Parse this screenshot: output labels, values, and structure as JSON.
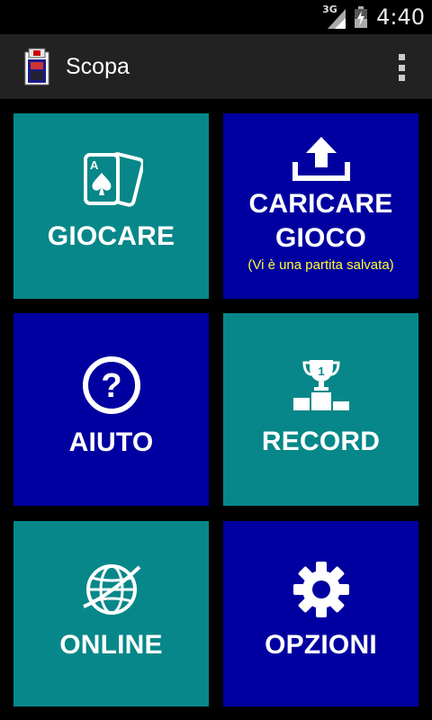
{
  "statusbar": {
    "network": "3G",
    "time": "4:40",
    "icons": [
      "signal-icon",
      "battery-charging-icon"
    ]
  },
  "appbar": {
    "title": "Scopa",
    "icons": [
      "app-logo-icon",
      "overflow-menu-icon"
    ]
  },
  "tiles": [
    {
      "label": "GIOCARE",
      "icon": "playing-cards-icon",
      "color": "#078789"
    },
    {
      "label": "CARICARE GIOCO",
      "line1": "CARICARE",
      "line2": "GIOCO",
      "subtitle": "(Vi è una partita salvata)",
      "icon": "upload-icon",
      "color": "#0000a0"
    },
    {
      "label": "AIUTO",
      "icon": "help-question-icon",
      "color": "#0000a0"
    },
    {
      "label": "RECORD",
      "icon": "trophy-podium-icon",
      "color": "#078789"
    },
    {
      "label": "ONLINE",
      "icon": "globe-icon",
      "color": "#078789"
    },
    {
      "label": "OPZIONI",
      "icon": "gear-icon",
      "color": "#0000a0"
    }
  ],
  "colors": {
    "teal": "#078789",
    "navy": "#0000a0",
    "appbar": "#222222",
    "subtitle": "#ffff33"
  }
}
